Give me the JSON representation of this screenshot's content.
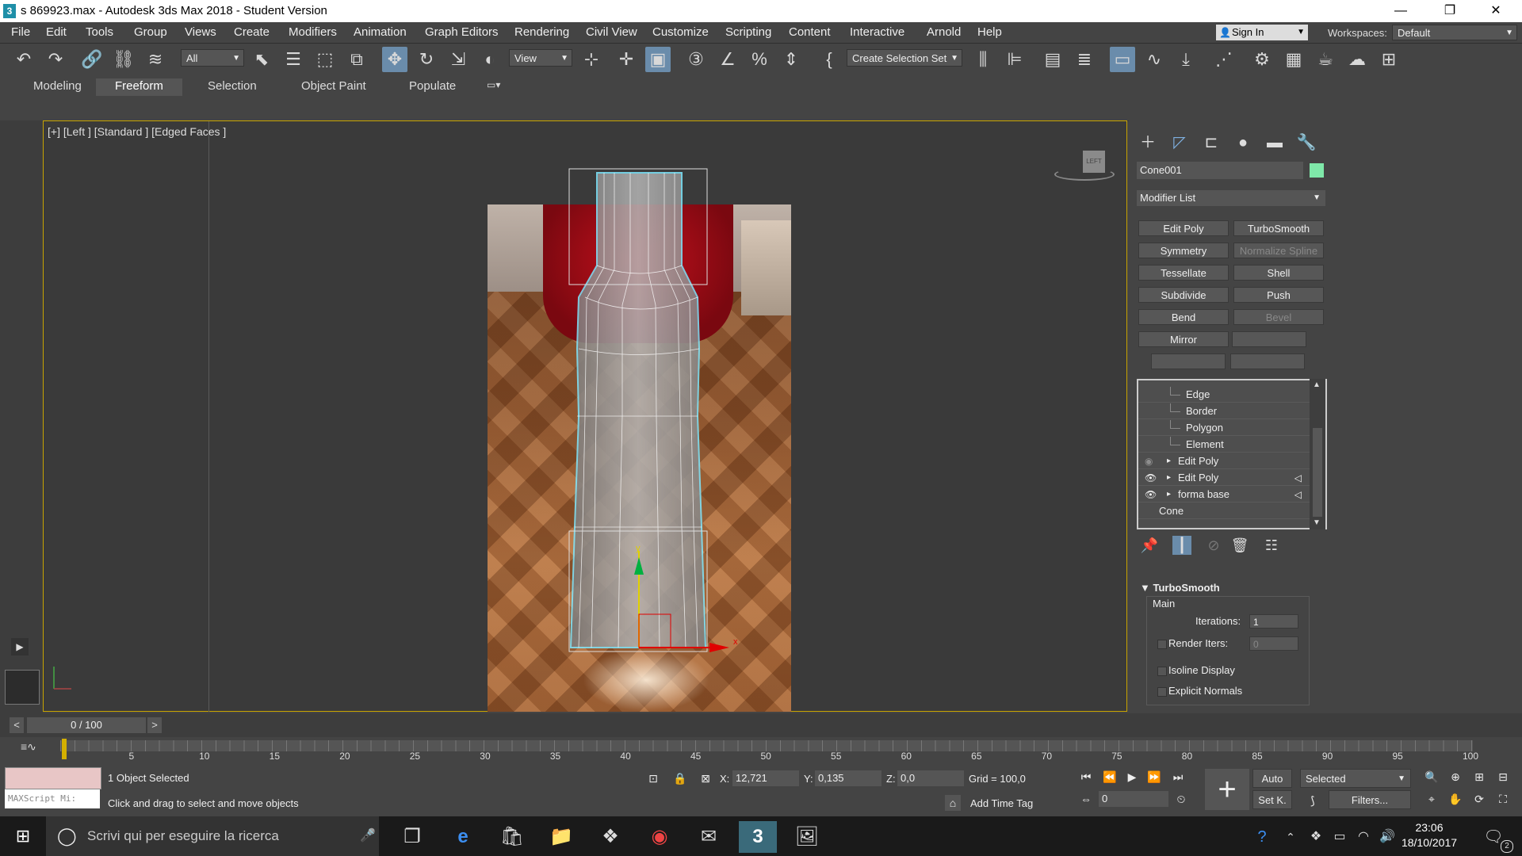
{
  "window": {
    "title": "s 869923.max - Autodesk 3ds Max 2018 - Student Version",
    "app_icon": "3",
    "controls": [
      "—",
      "❐",
      "✕"
    ]
  },
  "menu": {
    "items": [
      "File",
      "Edit",
      "Tools",
      "Group",
      "Views",
      "Create",
      "Modifiers",
      "Animation",
      "Graph Editors",
      "Rendering",
      "Civil View",
      "Customize",
      "Scripting",
      "Content",
      "Interactive",
      "Arnold",
      "Help"
    ],
    "sign_in": "Sign In",
    "workspaces_label": "Workspaces:",
    "workspace_value": "Default"
  },
  "toolbar": {
    "filter": "All",
    "ref_coord": "View",
    "selection_set": "Create Selection Set"
  },
  "ribbon": {
    "tabs": [
      "Modeling",
      "Freeform",
      "Selection",
      "Object Paint",
      "Populate"
    ],
    "active": "Freeform"
  },
  "viewport": {
    "label": "[+] [Left ] [Standard ] [Edged Faces ]",
    "viewcube_label": "LEFT",
    "gizmo_y": "y",
    "gizmo_x": "x"
  },
  "command_panel": {
    "object_name": "Cone001",
    "object_color": "#7fe8a9",
    "modifier_list": "Modifier List",
    "modifier_buttons": [
      {
        "label": "Edit Poly",
        "enabled": true
      },
      {
        "label": "TurboSmooth",
        "enabled": true
      },
      {
        "label": "Symmetry",
        "enabled": true
      },
      {
        "label": "Normalize Spline",
        "enabled": false
      },
      {
        "label": "Tessellate",
        "enabled": true
      },
      {
        "label": "Shell",
        "enabled": true
      },
      {
        "label": "Subdivide",
        "enabled": true
      },
      {
        "label": "Push",
        "enabled": true
      },
      {
        "label": "Bend",
        "enabled": true
      },
      {
        "label": "Bevel",
        "enabled": false
      },
      {
        "label": "Mirror",
        "enabled": true
      },
      {
        "label": "",
        "enabled": true
      },
      {
        "label": "",
        "enabled": true
      },
      {
        "label": "",
        "enabled": true
      }
    ],
    "stack": [
      {
        "label": "Edge",
        "level": "sub"
      },
      {
        "label": "Border",
        "level": "sub"
      },
      {
        "label": "Polygon",
        "level": "sub"
      },
      {
        "label": "Element",
        "level": "sub"
      },
      {
        "label": "Edit Poly",
        "level": "mod",
        "eye": "off",
        "tri": ""
      },
      {
        "label": "Edit Poly",
        "level": "mod",
        "eye": "on",
        "tri": "◁"
      },
      {
        "label": "forma base",
        "level": "mod",
        "eye": "on",
        "tri": "◁"
      },
      {
        "label": "Cone",
        "level": "base"
      }
    ],
    "turbosmooth": {
      "title": "TurboSmooth",
      "group": "Main",
      "iterations_label": "Iterations:",
      "iterations": "1",
      "render_iters_label": "Render Iters:",
      "render_iters": "0",
      "isoline": "Isoline Display",
      "explicit": "Explicit Normals"
    }
  },
  "timeline": {
    "frame": "0 / 100",
    "prev": "<",
    "next": ">",
    "ticks": [
      "5",
      "10",
      "15",
      "20",
      "25",
      "30",
      "35",
      "40",
      "45",
      "50",
      "55",
      "60",
      "65",
      "70",
      "75",
      "80",
      "85",
      "90",
      "95",
      "100"
    ]
  },
  "status": {
    "maxscript": "MAXScript Mi:",
    "selected": "1 Object Selected",
    "prompt": "Click and drag to select and move objects",
    "x_label": "X:",
    "x": "12,721",
    "y_label": "Y:",
    "y": "0,135",
    "z_label": "Z:",
    "z": "0,0",
    "grid": "Grid = 100,0",
    "add_time_tag": "Add Time Tag",
    "frame_field": "0",
    "auto": "Auto",
    "set_key": "Set K.",
    "key_filter": "Selected",
    "filters": "Filters..."
  },
  "taskbar": {
    "search_placeholder": "Scrivi qui per eseguire la ricerca",
    "time": "23:06",
    "date": "18/10/2017",
    "notif_count": "2"
  }
}
